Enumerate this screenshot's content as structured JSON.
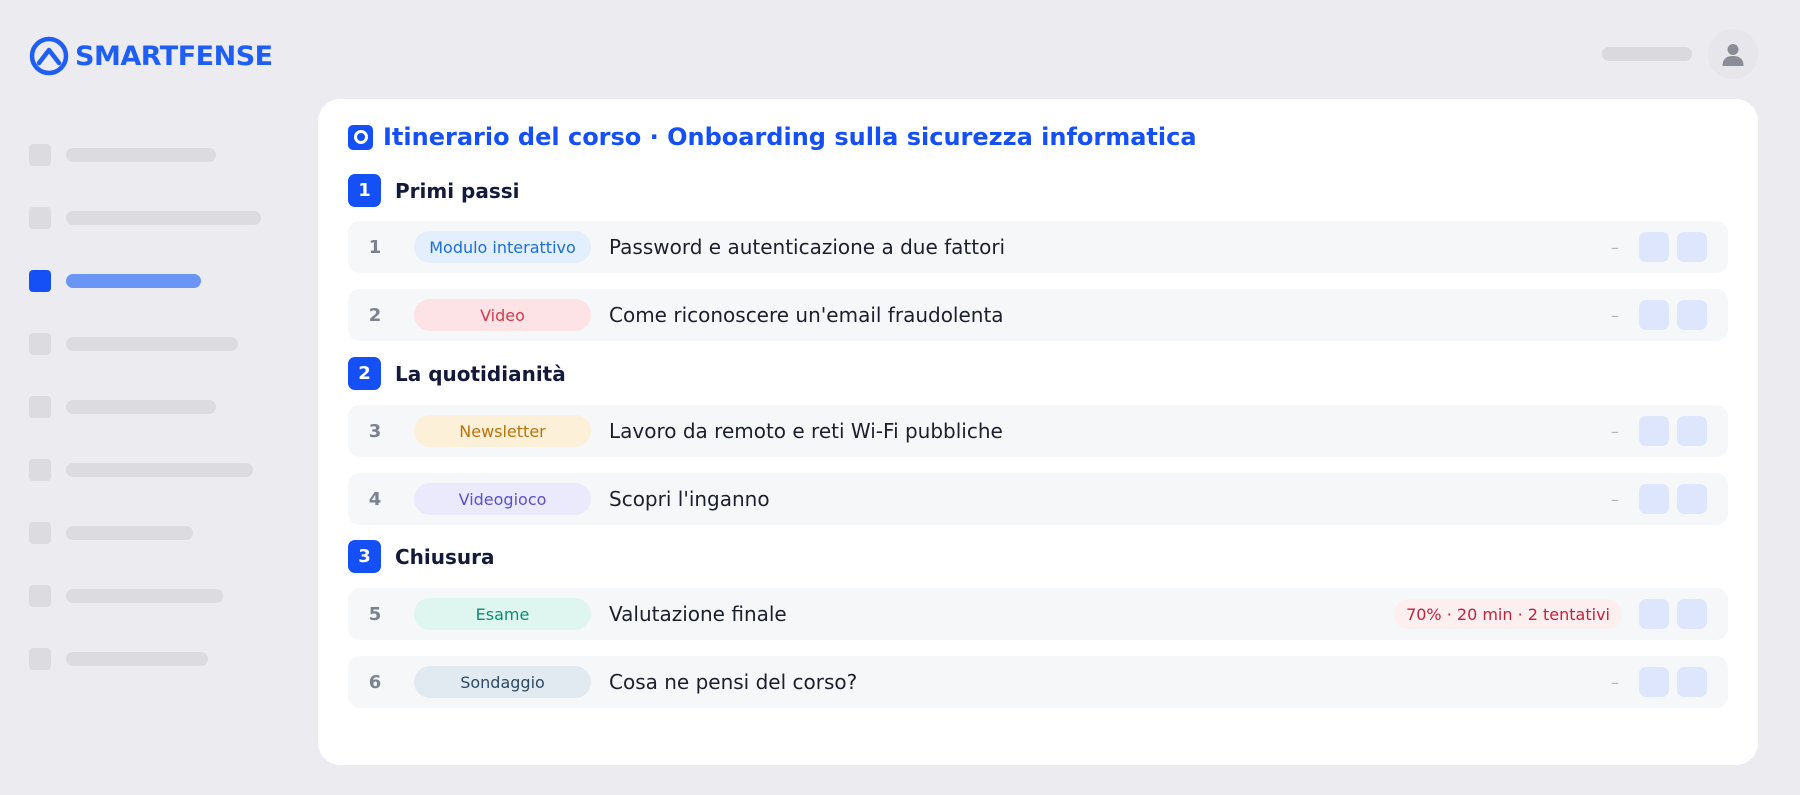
{
  "brand": {
    "name": "SMARTFENSE",
    "color": "#1f5ef5"
  },
  "header": {
    "avatar_icon": "user-icon"
  },
  "sidebar": {
    "items": [
      {
        "active": false
      },
      {
        "active": false
      },
      {
        "active": true
      },
      {
        "active": false
      },
      {
        "active": false
      },
      {
        "active": false
      },
      {
        "active": false
      },
      {
        "active": false
      },
      {
        "active": false
      }
    ]
  },
  "course": {
    "title": "Itinerario del corso · Onboarding sulla sicurezza informatica",
    "sections": [
      {
        "number": "1",
        "title": "Primi passi"
      },
      {
        "number": "2",
        "title": "La quotidianità"
      },
      {
        "number": "3",
        "title": "Chiusura"
      }
    ],
    "items": [
      {
        "number": "1",
        "type": "Modulo interattivo",
        "title": "Password e autenticazione a due fattori",
        "meta": "–",
        "type_color": "#1d6fd4",
        "type_bg": "#e3effc"
      },
      {
        "number": "2",
        "type": "Video",
        "title": "Come riconoscere un'email fraudolenta",
        "meta": "–",
        "type_color": "#d23a4a",
        "type_bg": "#fde3e6"
      },
      {
        "number": "3",
        "type": "Newsletter",
        "title": "Lavoro da remoto e reti Wi-Fi pubbliche",
        "meta": "–",
        "type_color": "#b8730a",
        "type_bg": "#fdf0d8"
      },
      {
        "number": "4",
        "type": "Videogioco",
        "title": "Scopri l'inganno",
        "meta": "–",
        "type_color": "#5b4fc8",
        "type_bg": "#ebe9fc"
      },
      {
        "number": "5",
        "type": "Esame",
        "title": "Valutazione finale",
        "meta": "70% · 20 min · 2 tentativi",
        "type_color": "#108a70",
        "type_bg": "#dff5ef"
      },
      {
        "number": "6",
        "type": "Sondaggio",
        "title": "Cosa ne pensi del corso?",
        "meta": "–",
        "type_color": "#2e4a63",
        "type_bg": "#e1eaf1"
      }
    ]
  }
}
